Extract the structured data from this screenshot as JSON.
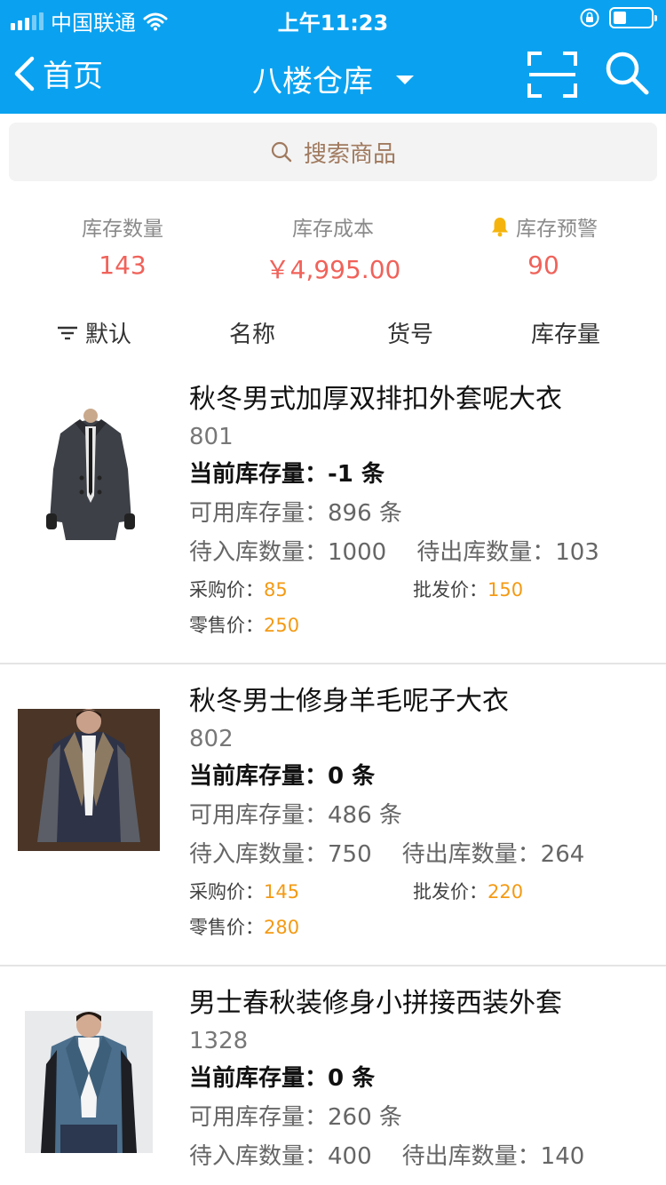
{
  "status_bar": {
    "carrier": "中国联通",
    "time": "上午11:23"
  },
  "nav": {
    "back_label": "首页",
    "title": "八楼仓库"
  },
  "search": {
    "placeholder": "搜索商品"
  },
  "summary": {
    "stock_count_label": "库存数量",
    "stock_count_value": "143",
    "stock_cost_label": "库存成本",
    "stock_cost_value": "￥4,995.00",
    "stock_alert_label": "库存预警",
    "stock_alert_value": "90"
  },
  "sort": {
    "default": "默认",
    "name": "名称",
    "code": "货号",
    "stock": "库存量"
  },
  "labels": {
    "current_stock": "当前库存量：",
    "available_stock": "可用库存量：",
    "pending_in": "待入库数量：",
    "pending_out": "待出库数量：",
    "purchase_price": "采购价：",
    "wholesale_price": "批发价：",
    "retail_price": "零售价："
  },
  "products": [
    {
      "name": "秋冬男式加厚双排扣外套呢大衣",
      "code": "801",
      "current_stock": "-1 条",
      "available_stock": "896 条",
      "pending_in": "1000",
      "pending_out": "103",
      "purchase_price": "85",
      "wholesale_price": "150",
      "retail_price": "250"
    },
    {
      "name": "秋冬男士修身羊毛呢子大衣",
      "code": "802",
      "current_stock": "0 条",
      "available_stock": "486 条",
      "pending_in": "750",
      "pending_out": "264",
      "purchase_price": "145",
      "wholesale_price": "220",
      "retail_price": "280"
    },
    {
      "name": "男士春秋装修身小拼接西装外套",
      "code": "1328",
      "current_stock": "0 条",
      "available_stock": "260 条",
      "pending_in": "400",
      "pending_out": "140"
    }
  ],
  "colors": {
    "brand_blue": "#0aa2f0",
    "value_red": "#f0625a",
    "price_orange": "#f49a14",
    "bell_yellow": "#f5b40d"
  }
}
